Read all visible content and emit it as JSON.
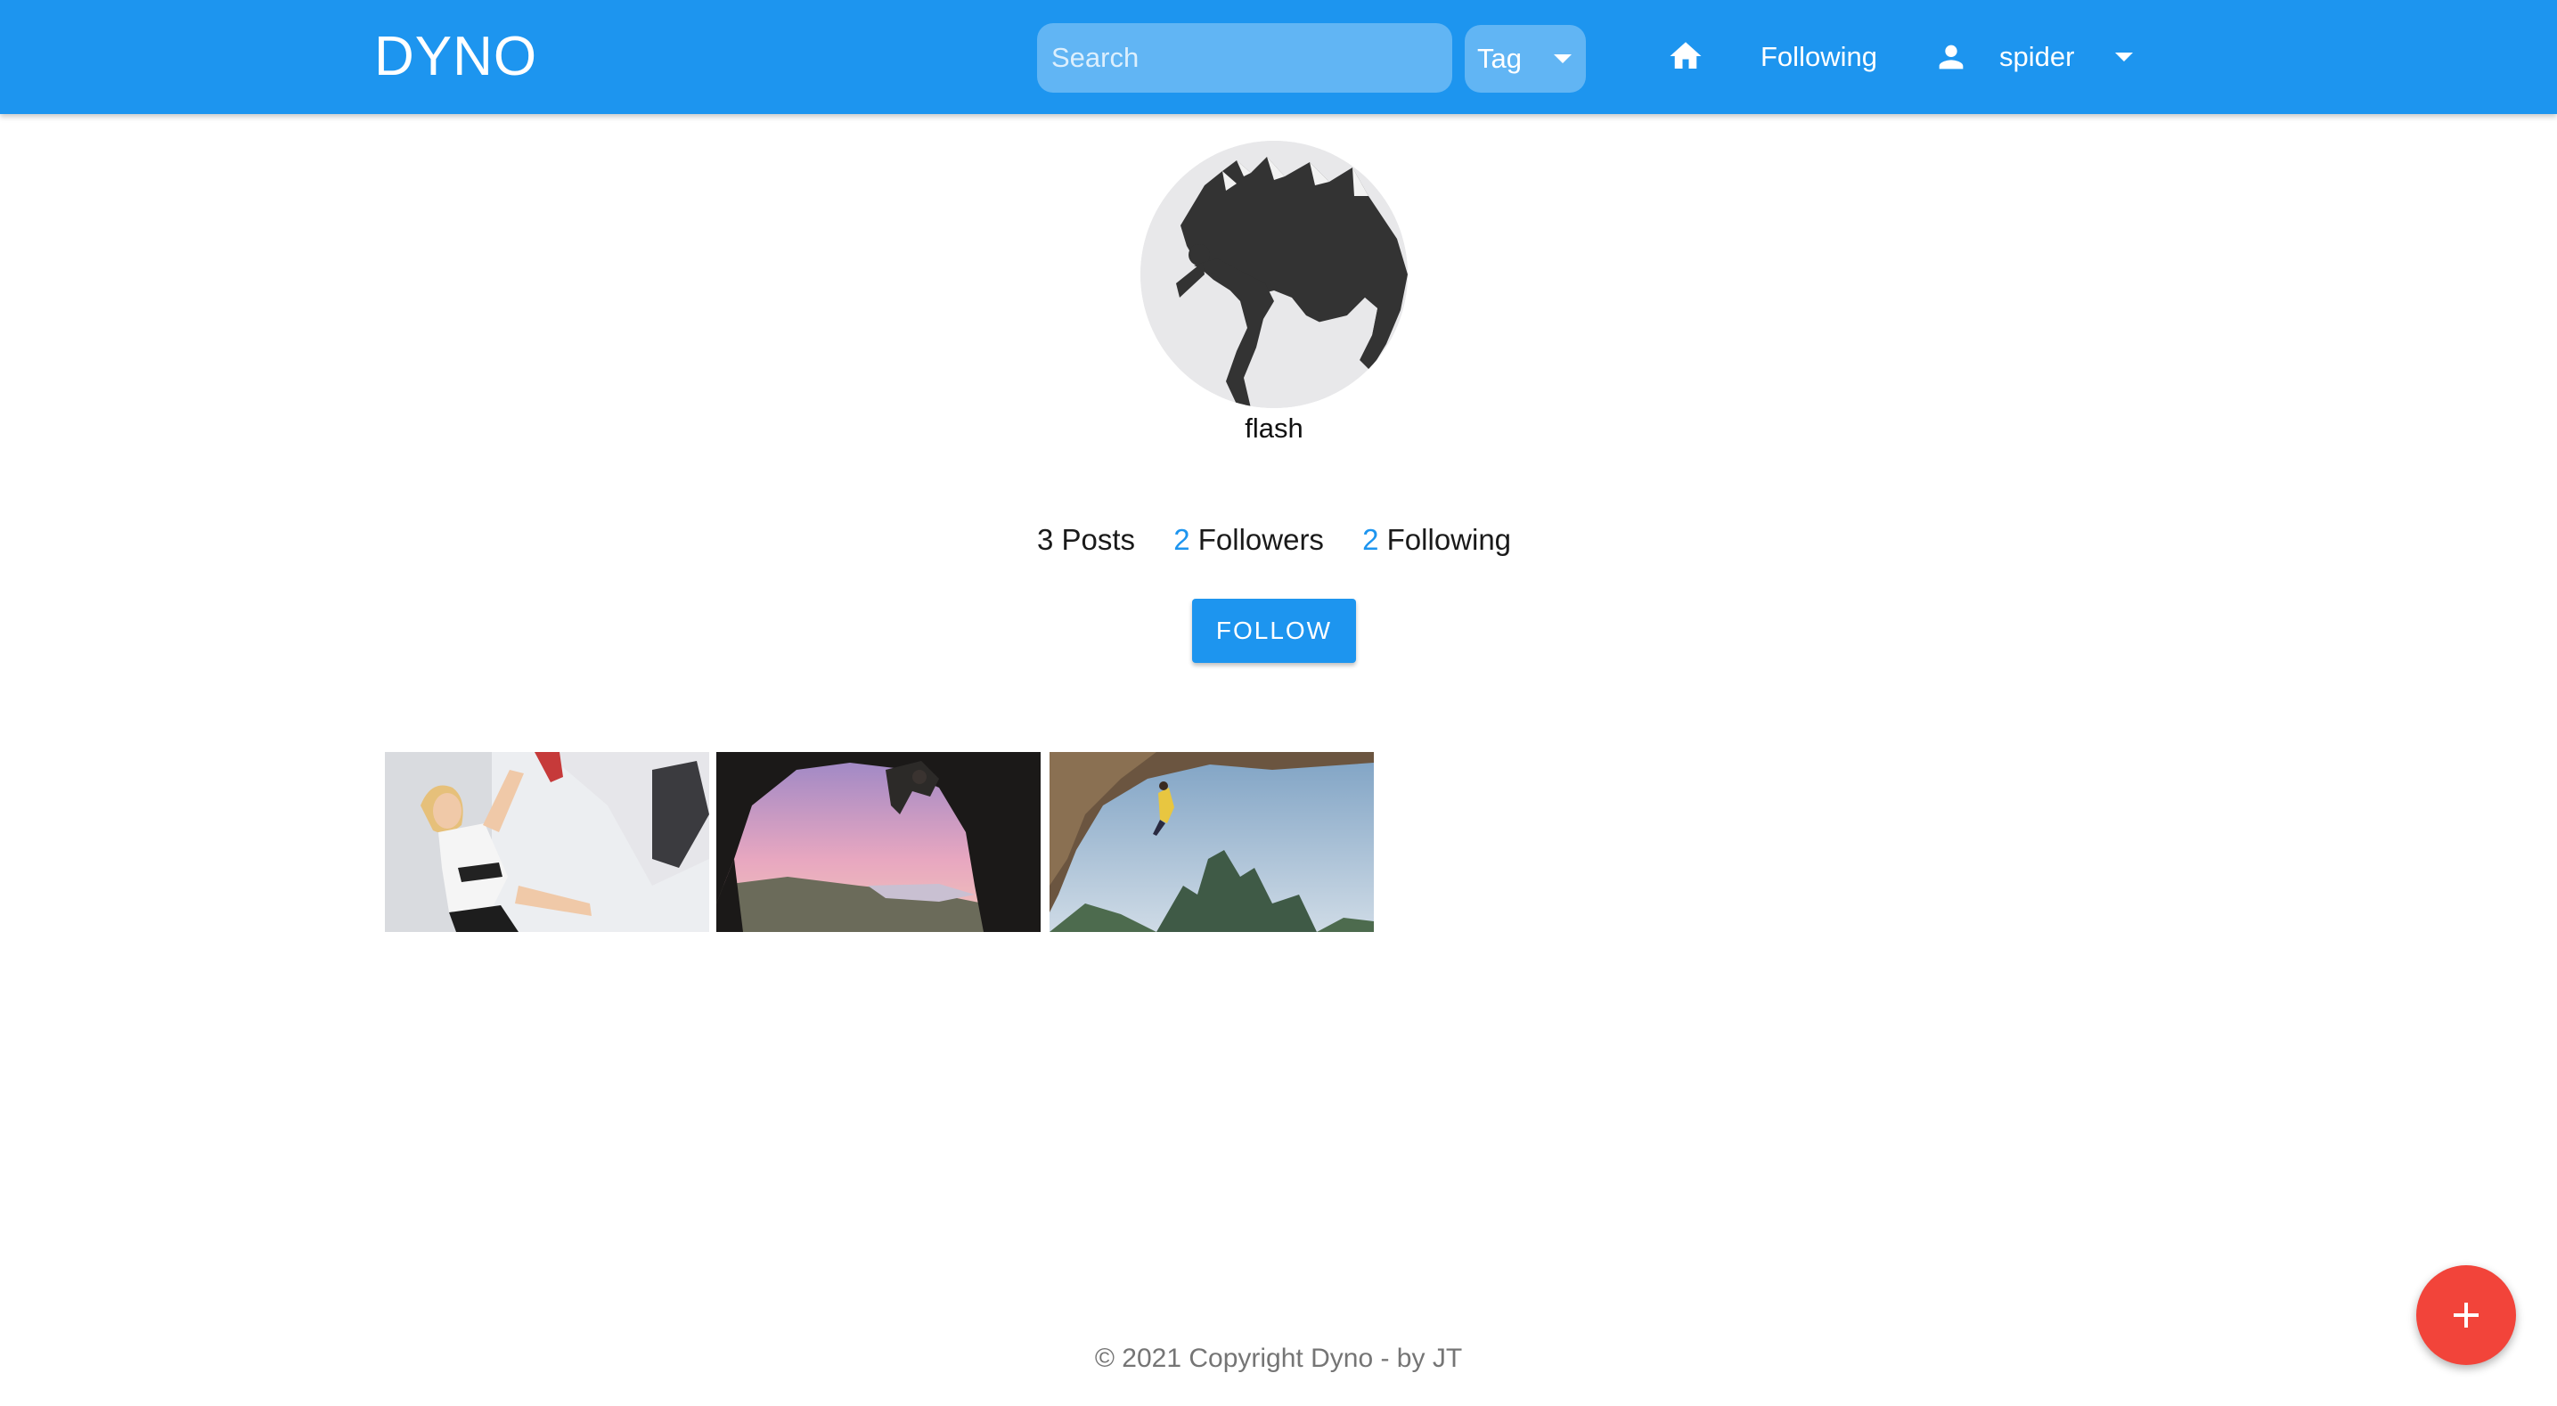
{
  "header": {
    "brand": "DYNO",
    "search": {
      "placeholder": "Search",
      "value": ""
    },
    "tag_select": {
      "label": "Tag",
      "icon": "chevron-down-icon"
    },
    "home_icon": "home-icon",
    "following_link": "Following",
    "user_menu": {
      "icon": "person-icon",
      "username": "spider",
      "caret_icon": "chevron-down-icon"
    },
    "accent_color": "#1d95ef"
  },
  "profile": {
    "avatar_alt": "climber silhouette on mountain",
    "username": "flash",
    "stats": {
      "posts": {
        "count": "3",
        "label": "Posts"
      },
      "followers": {
        "count": "2",
        "label": "Followers"
      },
      "following": {
        "count": "2",
        "label": "Following"
      }
    },
    "follow_button": "FOLLOW"
  },
  "posts": [
    {
      "image": "indoor-bouldering-photo"
    },
    {
      "image": "cave-climbing-sunset-photo"
    },
    {
      "image": "overhang-climbing-landscape-photo"
    }
  ],
  "footer": {
    "text": "© 2021 Copyright Dyno - by JT"
  },
  "fab": {
    "icon": "plus-icon",
    "color": "#f2443a"
  }
}
